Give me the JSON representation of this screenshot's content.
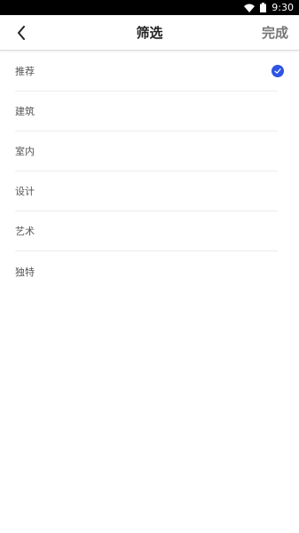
{
  "status_bar": {
    "time": "9:30"
  },
  "nav": {
    "title": "筛选",
    "done_label": "完成"
  },
  "filters": {
    "items": [
      {
        "label": "推荐",
        "selected": true
      },
      {
        "label": "建筑",
        "selected": false
      },
      {
        "label": "室内",
        "selected": false
      },
      {
        "label": "设计",
        "selected": false
      },
      {
        "label": "艺术",
        "selected": false
      },
      {
        "label": "独特",
        "selected": false
      }
    ]
  },
  "colors": {
    "accent": "#2d54e3",
    "status_bar": "#000000"
  },
  "icons": {
    "back": "chevron-left-icon",
    "check": "check-circle-icon",
    "wifi": "wifi-icon",
    "battery": "battery-icon"
  }
}
